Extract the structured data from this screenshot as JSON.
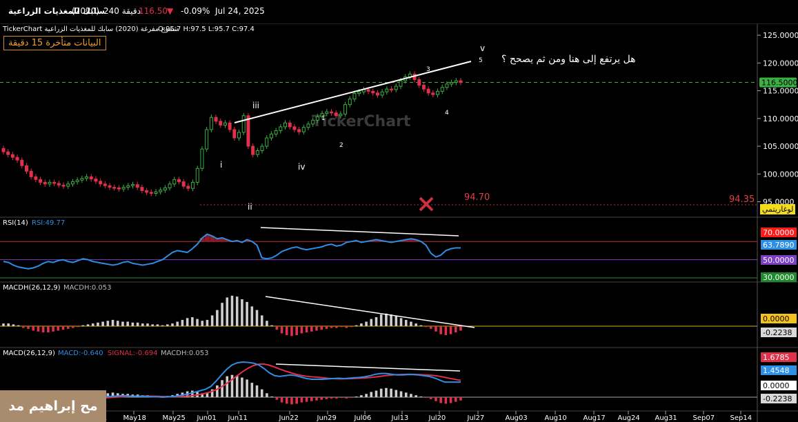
{
  "header": {
    "date": "Jul 24, 2025",
    "change_pct": "-0.09%",
    "price": "116.50",
    "interval": "240 دقيقة",
    "symbol": "(2020)",
    "name": "سابك للمغذيات الزراعية"
  },
  "price_panel": {
    "title": "TickerChart شموع مفرغة (2020) سابك للمغذيات الزراعية",
    "ohlc": "O:95.7  H:97.5  L:95.7  C:97.4",
    "delay_notice": "البيانات متأخرة 15 دقيقة",
    "question": "هل يرتفع إلى هنا ومن ثم يصحح ؟",
    "watermark": "TickerChart",
    "current_price_label": "116.5000",
    "level_a": "94.70",
    "level_b": "94.35",
    "scale_button": "لوغاريتمي",
    "y_ticks": [
      "125.0000",
      "120.0000",
      "115.0000",
      "110.0000",
      "105.0000",
      "100.0000",
      "95.0000"
    ],
    "wave_labels": [
      "i",
      "ii",
      "iii",
      "iv",
      "v",
      "1",
      "2",
      "3",
      "4",
      "5"
    ]
  },
  "rsi_panel": {
    "name": "RSI(14)",
    "value": "RSI:49.77",
    "levels": [
      "70.0000",
      "63.7890",
      "50.0000",
      "30.0000"
    ]
  },
  "macdh_panel": {
    "name": "MACDH(26,12,9)",
    "value": "MACDH:0.053",
    "labels": [
      "0.0000",
      "-0.2238"
    ]
  },
  "macd_panel": {
    "name": "MACD(26,12,9)",
    "macd": "MACD:-0.640",
    "signal": "SIGNAL:-0.694",
    "macdh": "MACDH:0.053",
    "labels": [
      "1.6785",
      "1.4548",
      "0.0000",
      "-0.2238"
    ]
  },
  "x_axis": [
    "1",
    "May18",
    "May25",
    "Jun01",
    "Jun11",
    "Jun22",
    "Jun29",
    "Jul06",
    "Jul13",
    "Jul20",
    "Jul27",
    "Aug03",
    "Aug10",
    "Aug17",
    "Aug24",
    "Aug31",
    "Sep07",
    "Sep14"
  ],
  "author": "مح إبراهيم مد",
  "colors": {
    "up": "#3cb043",
    "down": "#e0304a",
    "rsi": "#2d8fe6",
    "signal": "#e0304a",
    "hist": "#cfcfcf"
  },
  "chart_data": {
    "type": "line",
    "title": "",
    "xlabel": "",
    "ylabel": "",
    "ylim": [
      94,
      126
    ],
    "x": [
      "May18",
      "May25",
      "Jun01",
      "Jun11",
      "Jun22",
      "Jun29",
      "Jul06",
      "Jul13",
      "Jul20",
      "Jul24"
    ],
    "series": [
      {
        "name": "",
        "values": [
          98.5,
          97.5,
          96.5,
          97.8,
          109,
          107.5,
          110,
          115,
          116.5,
          116.5
        ]
      }
    ],
    "annotations": [
      {
        "text": "94.70",
        "y": 94.7
      },
      {
        "text": "94.35",
        "y": 94.35
      },
      {
        "text": "116.5000",
        "y": 116.5
      }
    ]
  }
}
